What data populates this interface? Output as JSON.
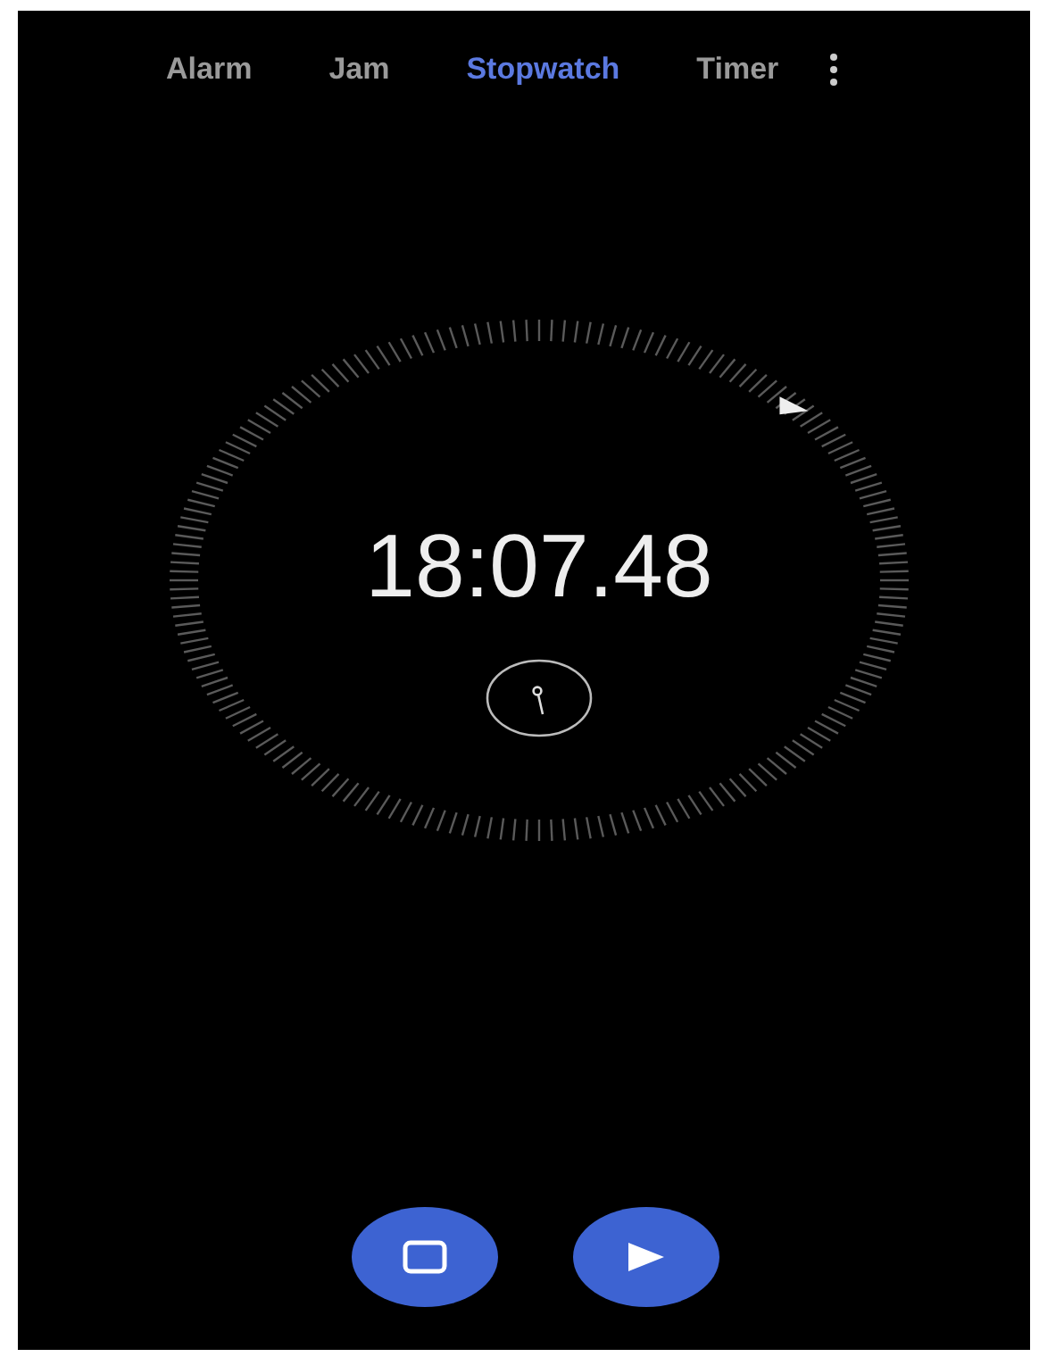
{
  "tabs": [
    {
      "label": "Alarm",
      "selected": false
    },
    {
      "label": "Jam",
      "selected": false
    },
    {
      "label": "Stopwatch",
      "selected": true
    },
    {
      "label": "Timer",
      "selected": false
    }
  ],
  "time": "18:07.48",
  "controls": [
    {
      "kind": "reset"
    },
    {
      "kind": "play"
    }
  ]
}
